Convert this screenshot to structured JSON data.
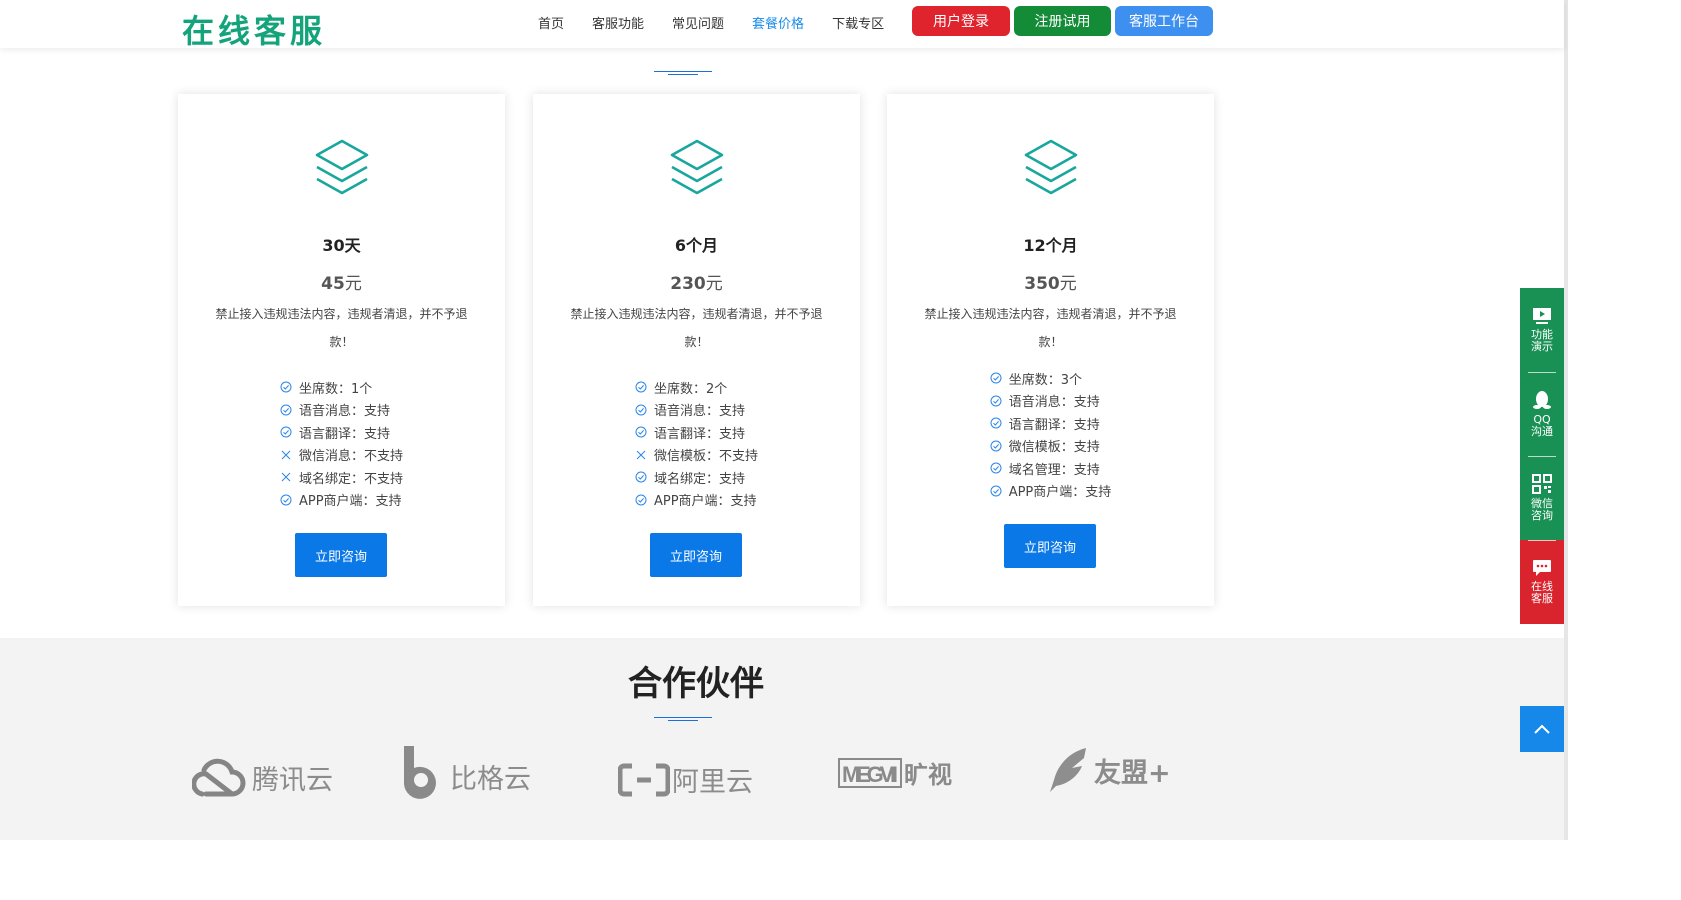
{
  "header": {
    "logo": "在线客服",
    "nav": [
      {
        "label": "首页",
        "active": false
      },
      {
        "label": "客服功能",
        "active": false
      },
      {
        "label": "常见问题",
        "active": false
      },
      {
        "label": "套餐价格",
        "active": true
      },
      {
        "label": "下载专区",
        "active": false
      }
    ],
    "buttons": {
      "login": "用户登录",
      "register": "注册试用",
      "workbench": "客服工作台"
    }
  },
  "plans": [
    {
      "title": "30天",
      "price_num": "45",
      "price_unit": "元",
      "note": "禁止接入违规违法内容，违规者清退，并不予退款！",
      "features": [
        {
          "label": "坐席数：1个",
          "ok": true
        },
        {
          "label": "语音消息：支持",
          "ok": true
        },
        {
          "label": "语言翻译：支持",
          "ok": true
        },
        {
          "label": "微信消息：不支持",
          "ok": false
        },
        {
          "label": "域名绑定：不支持",
          "ok": false
        },
        {
          "label": "APP商户端：支持",
          "ok": true
        }
      ],
      "cta": "立即咨询"
    },
    {
      "title": "6个月",
      "price_num": "230",
      "price_unit": "元",
      "note": "禁止接入违规违法内容，违规者清退，并不予退款！",
      "features": [
        {
          "label": "坐席数：2个",
          "ok": true
        },
        {
          "label": "语音消息：支持",
          "ok": true
        },
        {
          "label": "语言翻译：支持",
          "ok": true
        },
        {
          "label": "微信模板：不支持",
          "ok": false
        },
        {
          "label": "域名绑定：支持",
          "ok": true
        },
        {
          "label": "APP商户端：支持",
          "ok": true
        }
      ],
      "cta": "立即咨询"
    },
    {
      "title": "12个月",
      "price_num": "350",
      "price_unit": "元",
      "note": "禁止接入违规违法内容，违规者清退，并不予退款！",
      "features": [
        {
          "label": "坐席数：3个",
          "ok": true
        },
        {
          "label": "语音消息：支持",
          "ok": true
        },
        {
          "label": "语言翻译：支持",
          "ok": true
        },
        {
          "label": "微信模板：支持",
          "ok": true
        },
        {
          "label": "域名管理：支持",
          "ok": true
        },
        {
          "label": "APP商户端：支持",
          "ok": true
        }
      ],
      "cta": "立即咨询"
    }
  ],
  "partners": {
    "title": "合作伙伴",
    "logos": [
      {
        "name": "腾讯云",
        "icon": "cloud-icon"
      },
      {
        "name": "比格云",
        "icon": "b-letter-icon"
      },
      {
        "name": "阿里云",
        "icon": "bracket-icon"
      },
      {
        "name": "MEGVII旷视",
        "icon": "megvii-wordmark"
      },
      {
        "name": "友盟+",
        "icon": "feather-icon"
      }
    ]
  },
  "sidebar": {
    "items": [
      {
        "label": "功能\n演示",
        "icon": "play-screen-icon"
      },
      {
        "label": "QQ\n沟通",
        "icon": "qq-penguin-icon"
      },
      {
        "label": "微信\n咨询",
        "icon": "qrcode-icon"
      },
      {
        "label": "在线\n客服",
        "icon": "chat-bubble-icon"
      }
    ]
  },
  "colors": {
    "brand_green": "#14a37a",
    "accent_blue": "#0b78e8",
    "login_red": "#e0242e",
    "register_green": "#138b37",
    "workbench_blue": "#3d8ff0",
    "side_green": "#199155",
    "side_red": "#d9232d",
    "stack_icon": "#17a79c"
  }
}
